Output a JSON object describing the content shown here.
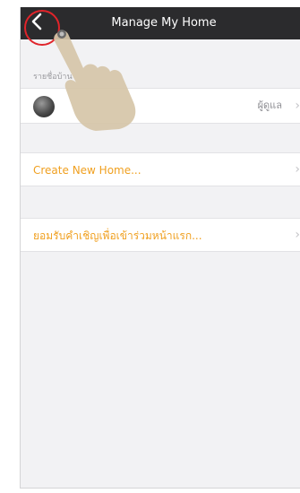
{
  "navbar": {
    "title": "Manage My Home",
    "back_icon": "chevron-left-icon"
  },
  "section": {
    "label": "รายชื่อบ้าน"
  },
  "home_row": {
    "role": "ผู้ดูแล",
    "chevron": "›"
  },
  "create_row": {
    "label": "Create New Home...",
    "chevron": "›"
  },
  "accept_row": {
    "label": "ยอมรับคำเชิญเพื่อเข้าร่วมหน้าแรก...",
    "chevron": "›"
  },
  "colors": {
    "accent": "#f0a020",
    "navbar": "#2b2b2d",
    "highlight": "#e0242a"
  }
}
